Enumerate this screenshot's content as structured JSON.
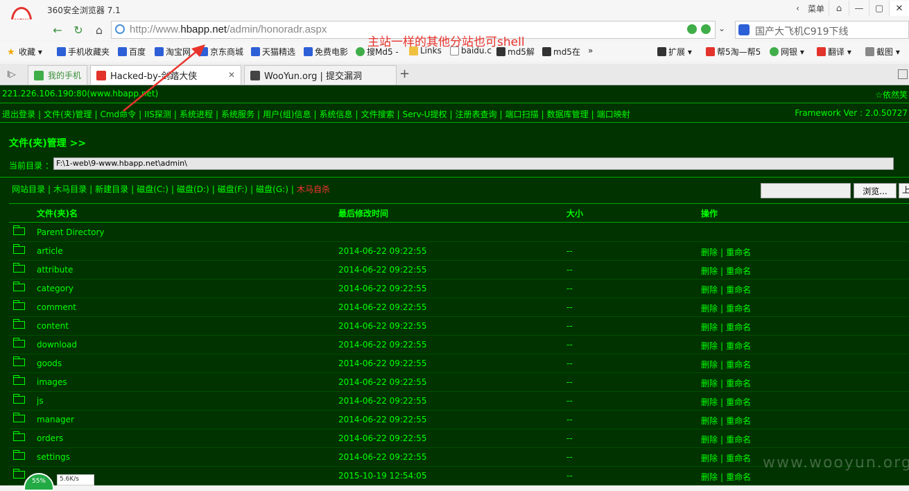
{
  "browser": {
    "app_title": "360安全浏览器 7.1",
    "logo_text": "NEW",
    "menu_label": "菜单",
    "url_prefix": "http://www.",
    "url_domain": "hbapp.net",
    "url_path": "/admin/honoradr.aspx",
    "search_text": "国产大飞机C919下线"
  },
  "bookmarks": [
    {
      "label": "收藏",
      "icon": "star-icon"
    },
    {
      "label": "手机收藏夹",
      "icon": "phone-icon"
    },
    {
      "label": "百度",
      "icon": "paw-icon"
    },
    {
      "label": "淘宝网",
      "icon": "paw-icon"
    },
    {
      "label": "京东商城",
      "icon": "paw-icon"
    },
    {
      "label": "天猫精选",
      "icon": "paw-icon"
    },
    {
      "label": "免费电影",
      "icon": "paw-icon"
    },
    {
      "label": "搜Md5 -",
      "icon": "globe-icon"
    },
    {
      "label": "Links",
      "icon": "folder-icon"
    },
    {
      "label": "baidu.c",
      "icon": "doc-icon"
    },
    {
      "label": "md5解",
      "icon": "md5-icon"
    },
    {
      "label": "md5在",
      "icon": "grid-icon"
    },
    {
      "label": "»",
      "icon": ""
    },
    {
      "label": "扩展",
      "icon": "grid-icon"
    },
    {
      "label": "帮5淘—帮5",
      "icon": "cart-icon"
    },
    {
      "label": "网银",
      "icon": "bank-icon"
    },
    {
      "label": "翻译",
      "icon": "translate-icon"
    },
    {
      "label": "截图",
      "icon": "scissors-icon"
    }
  ],
  "tabs": [
    {
      "label": "我的手机"
    },
    {
      "label": "Hacked-by-剑踏大侠"
    },
    {
      "label": "WooYun.org | 提交漏洞"
    }
  ],
  "annotation": "主站一样的其他分站也可shell",
  "shell": {
    "ip": "221.226.106.190:80(www.hbapp.net)",
    "ip_right": "☆依然笑",
    "menu": [
      "退出登录",
      "文件(夹)管理",
      "Cmd命令",
      "IIS探测",
      "系统进程",
      "系统服务",
      "用户(组)信息",
      "系统信息",
      "文件搜索",
      "Serv-U提权",
      "注册表查询",
      "端口扫描",
      "数据库管理",
      "端口映射"
    ],
    "framework": "Framework Ver : 2.0.50727",
    "section_title": "文件(夹)管理  >>",
    "curdir_label": "当前目录 ：",
    "curdir_value": "F:\\1-web\\9-www.hbapp.net\\admin\\",
    "dir_links": [
      "网站目录",
      "木马目录",
      "新建目录",
      "磁盘(C:)",
      "磁盘(D:)",
      "磁盘(F:)",
      "磁盘(G:)"
    ],
    "self_delete": "木马自杀",
    "browse_label": "浏览...",
    "upload_label": "上",
    "headers": {
      "name": "文件(夹)名",
      "time": "最后修改时间",
      "size": "大小",
      "ops": "操作"
    },
    "rows": [
      {
        "name": "Parent Directory",
        "time": "",
        "size": "",
        "delete": "",
        "rename": ""
      },
      {
        "name": "article",
        "time": "2014-06-22 09:22:55",
        "size": "--",
        "delete": "删除",
        "rename": "重命名"
      },
      {
        "name": "attribute",
        "time": "2014-06-22 09:22:55",
        "size": "--",
        "delete": "删除",
        "rename": "重命名"
      },
      {
        "name": "category",
        "time": "2014-06-22 09:22:55",
        "size": "--",
        "delete": "删除",
        "rename": "重命名"
      },
      {
        "name": "comment",
        "time": "2014-06-22 09:22:55",
        "size": "--",
        "delete": "删除",
        "rename": "重命名"
      },
      {
        "name": "content",
        "time": "2014-06-22 09:22:55",
        "size": "--",
        "delete": "删除",
        "rename": "重命名"
      },
      {
        "name": "download",
        "time": "2014-06-22 09:22:55",
        "size": "--",
        "delete": "删除",
        "rename": "重命名"
      },
      {
        "name": "goods",
        "time": "2014-06-22 09:22:55",
        "size": "--",
        "delete": "删除",
        "rename": "重命名"
      },
      {
        "name": "images",
        "time": "2014-06-22 09:22:55",
        "size": "--",
        "delete": "删除",
        "rename": "重命名"
      },
      {
        "name": "js",
        "time": "2014-06-22 09:22:55",
        "size": "--",
        "delete": "删除",
        "rename": "重命名"
      },
      {
        "name": "manager",
        "time": "2014-06-22 09:22:55",
        "size": "--",
        "delete": "删除",
        "rename": "重命名"
      },
      {
        "name": "orders",
        "time": "2014-06-22 09:22:55",
        "size": "--",
        "delete": "删除",
        "rename": "重命名"
      },
      {
        "name": "settings",
        "time": "2014-06-22 09:22:55",
        "size": "--",
        "delete": "删除",
        "rename": "重命名"
      },
      {
        "name": "",
        "time": "2015-10-19 12:54:05",
        "size": "--",
        "delete": "删除",
        "rename": "重命名"
      }
    ]
  },
  "watermark": "www.wooyun.org",
  "speed": {
    "percent": "55%",
    "rate": "5.6K/s"
  },
  "colors": {
    "page_bg": "#003300",
    "text": "#00ff00",
    "danger": "#ff3333",
    "annotation": "#e8332c"
  }
}
